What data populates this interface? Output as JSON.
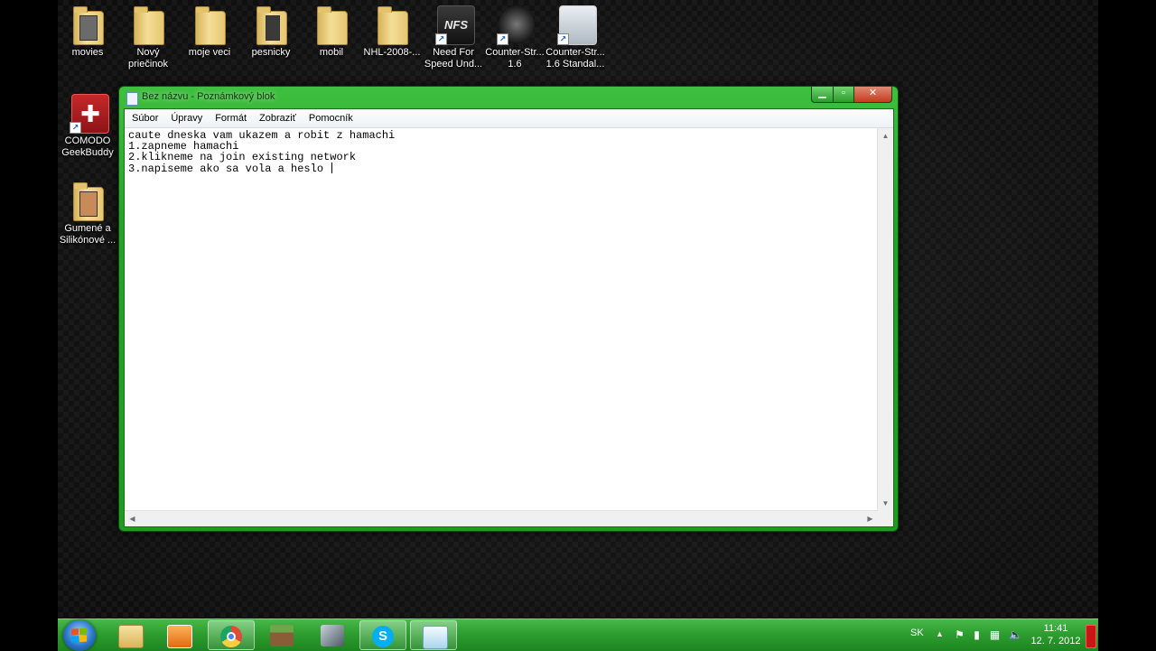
{
  "desktop": {
    "icons": [
      {
        "label": "movies",
        "icon": "folder-icon"
      },
      {
        "label": "Nový\npriečinok",
        "icon": "folder-icon"
      },
      {
        "label": "moje veci",
        "icon": "folder-icon"
      },
      {
        "label": "pesnicky",
        "icon": "folder-icon"
      },
      {
        "label": "mobil",
        "icon": "folder-icon"
      },
      {
        "label": "NHL-2008-...",
        "icon": "folder-icon"
      },
      {
        "label": "Need For\nSpeed Und...",
        "icon": "nfs-shortcut-icon"
      },
      {
        "label": "Counter-Str...\n1.6",
        "icon": "counter-strike-shortcut-icon"
      },
      {
        "label": "Counter-Str...\n1.6 Standal...",
        "icon": "counter-strike-shortcut-icon"
      },
      {
        "label": "COMODO\nGeekBuddy",
        "icon": "comodo-geekbuddy-icon"
      },
      {
        "label": "Gumené a\nSilikónové ...",
        "icon": "folder-icon"
      }
    ]
  },
  "notepad": {
    "title": "Bez názvu - Poznámkový blok",
    "menu": [
      "Súbor",
      "Úpravy",
      "Formát",
      "Zobraziť",
      "Pomocník"
    ],
    "lines": [
      "caute dneska vam ukazem a robit z hamachi",
      "1.zapneme hamachi",
      "2.klikneme na join existing network",
      "3.napiseme ako sa vola a heslo "
    ]
  },
  "taskbar": {
    "pinned": [
      {
        "name": "explorer",
        "icon": "folder-icon",
        "color": "#e9c46a"
      },
      {
        "name": "media-player",
        "icon": "media-player-icon",
        "color": "#f08a24"
      },
      {
        "name": "chrome",
        "icon": "chrome-icon",
        "color": "#dd4b39"
      },
      {
        "name": "minecraft",
        "icon": "minecraft-icon",
        "color": "#6b8e3a"
      },
      {
        "name": "game",
        "icon": "game-icon",
        "color": "#7a8a96"
      },
      {
        "name": "skype",
        "icon": "skype-icon",
        "color": "#00aff0"
      },
      {
        "name": "notepad",
        "icon": "notepad-icon",
        "color": "#bfe4f2"
      }
    ],
    "language": "SK",
    "time": "11:41",
    "date": "12. 7. 2012"
  },
  "colors": {
    "window_frame": "#25a525",
    "taskbar": "#2e9e30",
    "close_button": "#c43c1e"
  }
}
